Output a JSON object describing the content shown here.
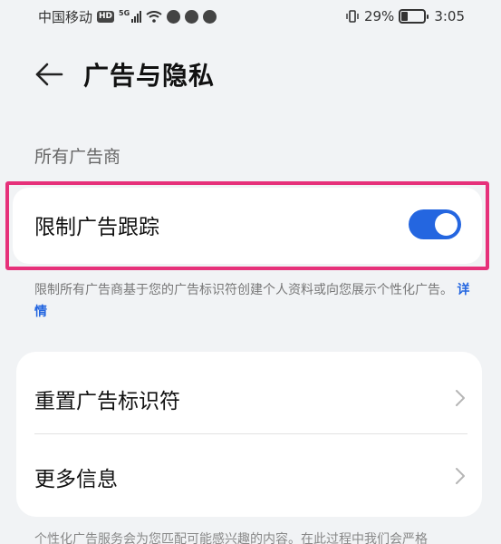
{
  "status_bar": {
    "carrier": "中国移动",
    "hd_badge": "HD",
    "network": "5G",
    "battery_percent_text": "29%",
    "battery_level": 0.29,
    "time": "3:05"
  },
  "header": {
    "title": "广告与隐私"
  },
  "section": {
    "label": "所有广告商"
  },
  "limit_tracking": {
    "label": "限制广告跟踪",
    "enabled": true
  },
  "description": {
    "text": "限制所有广告商基于您的广告标识符创建个人资料或向您展示个性化广告。",
    "link": "详情"
  },
  "menu": {
    "items": [
      {
        "label": "重置广告标识符"
      },
      {
        "label": "更多信息"
      }
    ]
  },
  "footer": {
    "text": "个性化广告服务会为您匹配可能感兴趣的内容。在此过程中我们会严格"
  },
  "colors": {
    "accent": "#2466e0",
    "highlight": "#e6317a",
    "background": "#f1f3f5"
  }
}
